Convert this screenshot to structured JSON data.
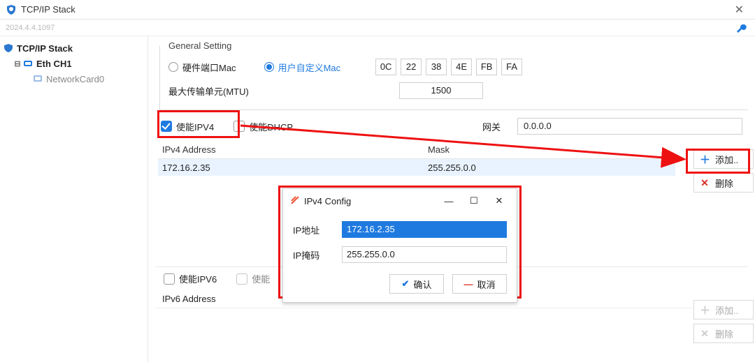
{
  "window": {
    "title": "TCP/IP Stack",
    "build_info": "2024.4.4.1097"
  },
  "tree": {
    "root": {
      "label": "TCP/IP Stack"
    },
    "eth": {
      "label": "Eth CH1"
    },
    "nic": {
      "label": "NetworkCard0"
    }
  },
  "general": {
    "legend": "General Setting",
    "radio_hw_mac": "硬件端口Mac",
    "radio_user_mac": "用户自定义Mac",
    "mac": [
      "0C",
      "22",
      "38",
      "4E",
      "FB",
      "FA"
    ],
    "mtu_label": "最大传输单元(MTU)",
    "mtu_value": "1500"
  },
  "ipv4": {
    "enable_label": "使能IPV4",
    "dhcp_label": "使能DHCP",
    "gateway_label": "网关",
    "gateway_value": "0.0.0.0",
    "col_addr": "IPv4 Address",
    "col_mask": "Mask",
    "row_addr": "172.16.2.35",
    "row_mask": "255.255.0.0",
    "btn_add": "添加..",
    "btn_del": "删除"
  },
  "ipv6": {
    "enable_label": "使能IPV6",
    "extra_label": "使能",
    "col_addr": "IPv6 Address",
    "btn_add": "添加..",
    "btn_del": "删除"
  },
  "modal": {
    "title": "IPv4 Config",
    "ip_label": "IP地址",
    "mask_label": "IP掩码",
    "ip_value": "172.16.2.35",
    "mask_value": "255.255.0.0",
    "ok": "确认",
    "cancel": "取消"
  }
}
